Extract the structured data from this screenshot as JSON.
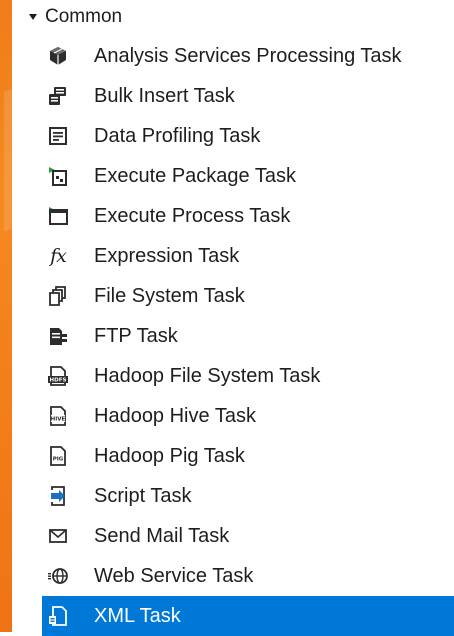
{
  "theme": {
    "accent": "#f47f1a",
    "selection": "#0078d7",
    "text": "#1e1e1e"
  },
  "group": {
    "label": "Common",
    "expanded": true,
    "icon": "triangle-down-icon"
  },
  "items": [
    {
      "label": "Analysis Services Processing Task",
      "icon": "cube-icon"
    },
    {
      "label": "Bulk Insert Task",
      "icon": "database-insert-icon"
    },
    {
      "label": "Data Profiling Task",
      "icon": "document-list-icon"
    },
    {
      "label": "Execute Package Task",
      "icon": "package-icon"
    },
    {
      "label": "Execute Process Task",
      "icon": "window-process-icon"
    },
    {
      "label": "Expression Task",
      "icon": "fx-icon",
      "glyph": "fx"
    },
    {
      "label": "File System Task",
      "icon": "file-system-icon"
    },
    {
      "label": "FTP Task",
      "icon": "ftp-icon"
    },
    {
      "label": "Hadoop File System Task",
      "icon": "hdfs-icon",
      "badge": "HDFS"
    },
    {
      "label": "Hadoop Hive Task",
      "icon": "hive-icon",
      "badge": "HIVE"
    },
    {
      "label": "Hadoop Pig Task",
      "icon": "pig-icon",
      "badge": "PIG"
    },
    {
      "label": "Script Task",
      "icon": "script-icon"
    },
    {
      "label": "Send Mail Task",
      "icon": "mail-icon"
    },
    {
      "label": "Web Service Task",
      "icon": "web-service-icon"
    },
    {
      "label": "XML Task",
      "icon": "xml-icon",
      "selected": true
    }
  ]
}
